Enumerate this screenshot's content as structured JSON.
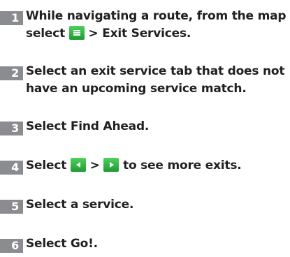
{
  "steps": [
    {
      "number": "1",
      "line1": "While navigating a route, from the map",
      "line2_pre": "select",
      "icon": "menu-icon",
      "line2_post": "> Exit Services."
    },
    {
      "number": "2",
      "line1": "Select an exit service tab that does not",
      "line2": "have an upcoming service match."
    },
    {
      "number": "3",
      "text": "Select Find Ahead."
    },
    {
      "number": "4",
      "text_pre": "Select",
      "icon1": "arrow-left-icon",
      "separator": ">",
      "icon2": "arrow-right-icon",
      "text_post": "to see more exits."
    },
    {
      "number": "5",
      "text": "Select a service."
    },
    {
      "number": "6",
      "text": "Select Go!."
    }
  ],
  "colors": {
    "number_badge": "#8a8c8f",
    "icon_button": "#2db844",
    "text": "#231f20"
  }
}
